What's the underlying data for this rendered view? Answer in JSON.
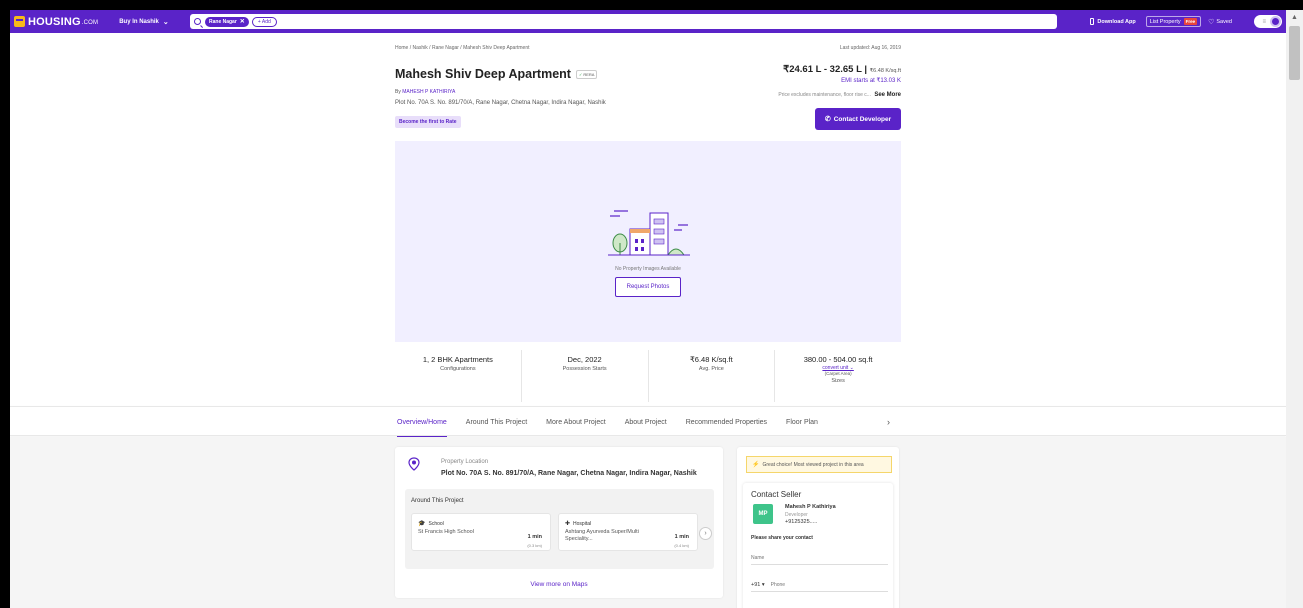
{
  "nav": {
    "logo_text": "HOUSING",
    "logo_suffix": ".COM",
    "city_menu": "Buy In Nashik",
    "search_chip": "Rane Nagar",
    "add_chip": "+ Add",
    "download_app": "Download App",
    "list_property": "List Property",
    "free_badge": "Free",
    "saved": "Saved"
  },
  "project": {
    "breadcrumb": "Home / Nashik / Rane Nagar / Mahesh Shiv Deep Apartment",
    "last_updated": "Last updated: Aug 16, 2019",
    "title": "Mahesh Shiv Deep Apartment",
    "rera": "RERA",
    "by_label": "By",
    "developer": "MAHESH P KATHIRIYA",
    "address": "Plot No. 70A S. No. 891/70/A, Rane Nagar, Chetna Nagar, Indira Nagar, Nashik",
    "rate_cta": "Become the first to Rate",
    "price": "₹24.61 L - 32.65 L |",
    "price_per_sqft": "₹6.48 K/sq.ft",
    "emi": "EMI starts at ₹13.03 K",
    "price_note": "Price excludes maintenance, floor rise c...",
    "see_more": "See More",
    "contact_developer": "Contact Developer"
  },
  "gallery": {
    "no_images": "No Property Images Available",
    "request_photos": "Request Photos"
  },
  "stats": [
    {
      "value": "1, 2 BHK Apartments",
      "label": "Configurations"
    },
    {
      "value": "Dec, 2022",
      "label": "Possession Starts"
    },
    {
      "value": "₹6.48 K/sq.ft",
      "label": "Avg. Price"
    },
    {
      "value": "380.00 - 504.00 sq.ft",
      "convert": "convert unit ⌄",
      "carpet": "(Carpet Area)",
      "label": "Sizes"
    }
  ],
  "tabs": [
    "Overview/Home",
    "Around This Project",
    "More About Project",
    "About Project",
    "Recommended Properties",
    "Floor Plan"
  ],
  "location": {
    "label": "Property Location",
    "address": "Plot No. 70A S. No. 891/70/A, Rane Nagar, Chetna Nagar, Indira Nagar, Nashik",
    "around_title": "Around This Project",
    "pois": [
      {
        "category": "School",
        "name": "St Francis High School",
        "time": "1 min",
        "distance": "(0.3 km)"
      },
      {
        "category": "Hospital",
        "name": "Ashtang Ayurveda Super/Multi Speciality...",
        "time": "1 min",
        "distance": "(0.4 km)"
      }
    ],
    "view_maps": "View more on Maps"
  },
  "sidebar": {
    "great_choice": "Great choice! Most viewed project in this area",
    "contact_title": "Contact Seller",
    "seller_initials": "MP",
    "seller_name": "Mahesh P Kathiriya",
    "seller_role": "Developer",
    "seller_phone": "+9125325.....",
    "share_prompt": "Please share your contact",
    "name_placeholder": "Name",
    "country_code": "+91 ▾",
    "phone_placeholder": "Phone"
  },
  "colors": {
    "brand": "#5a23c8",
    "accent_bg": "#f1efff",
    "success": "#3ec48a"
  }
}
